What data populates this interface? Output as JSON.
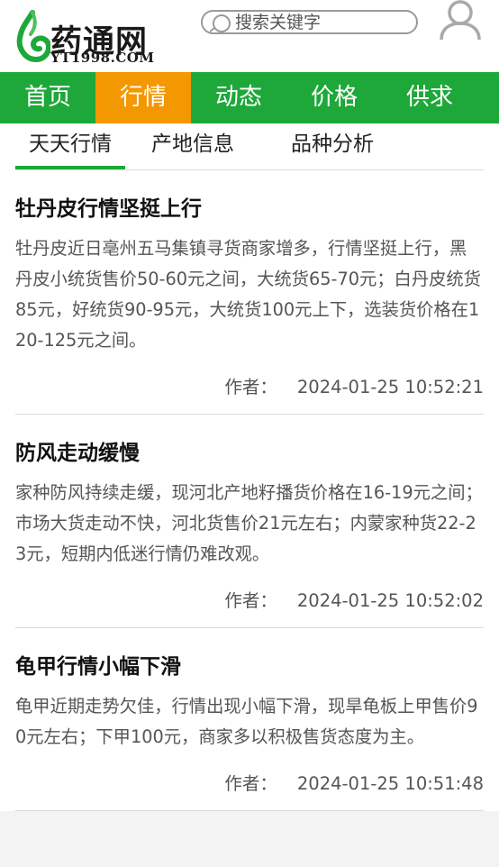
{
  "header": {
    "logo_text": "药通网",
    "logo_domain": "YT1998.COM",
    "search_placeholder": "搜索关键字"
  },
  "nav": {
    "items": [
      {
        "label": "首页"
      },
      {
        "label": "行情"
      },
      {
        "label": "动态"
      },
      {
        "label": "价格"
      },
      {
        "label": "供求"
      }
    ],
    "active_index": 1
  },
  "subtabs": {
    "items": [
      {
        "label": "天天行情"
      },
      {
        "label": "产地信息"
      },
      {
        "label": "品种分析"
      }
    ],
    "active_index": 0
  },
  "articles": [
    {
      "title": "牡丹皮行情坚挺上行",
      "body": "牡丹皮近日亳州五马集镇寻货商家增多，行情坚挺上行，黑丹皮小统货售价50-60元之间，大统货65-70元；白丹皮统货85元，好统货90-95元，大统货100元上下，选装货价格在120-125元之间。",
      "author_label": "作者：",
      "time": "2024-01-25 10:52:21"
    },
    {
      "title": "防风走动缓慢",
      "body": "家种防风持续走缓，现河北产地籽播货价格在16-19元之间；市场大货走动不快，河北货售价21元左右；内蒙家种货22-23元，短期内低迷行情仍难改观。",
      "author_label": "作者：",
      "time": "2024-01-25 10:52:02"
    },
    {
      "title": "龟甲行情小幅下滑",
      "body": "龟甲近期走势欠佳，行情出现小幅下滑，现旱龟板上甲售价90元左右；下甲100元，商家多以积极售货态度为主。",
      "author_label": "作者：",
      "time": "2024-01-25 10:51:48"
    }
  ],
  "colors": {
    "brand_green": "#1ea83a",
    "active_orange": "#f39800"
  }
}
